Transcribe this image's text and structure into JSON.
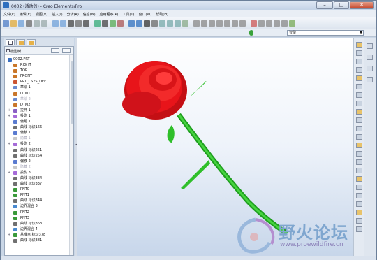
{
  "window": {
    "title": "0002 (活动的) - Creo Elements/Pro",
    "minimize": "–",
    "maximize": "□",
    "close": "✕"
  },
  "menu": [
    "文件(F)",
    "编辑(E)",
    "视图(V)",
    "插入(I)",
    "分析(A)",
    "信息(N)",
    "应用程序(P)",
    "工具(T)",
    "窗口(W)",
    "帮助(H)"
  ],
  "toolbar2": {
    "smart_filter": "智能"
  },
  "panel": {
    "title": "模型树"
  },
  "tree": [
    {
      "label": "0002.PRT",
      "icon": "part-icon",
      "exp": "",
      "dim": false,
      "indent": 0
    },
    {
      "label": "RIGHT",
      "icon": "datum-plane-icon",
      "exp": "",
      "dim": false,
      "indent": 1
    },
    {
      "label": "TOP",
      "icon": "datum-plane-icon",
      "exp": "",
      "dim": false,
      "indent": 1
    },
    {
      "label": "FRONT",
      "icon": "datum-plane-icon",
      "exp": "",
      "dim": false,
      "indent": 1
    },
    {
      "label": "PRT_CSYS_DEF",
      "icon": "csys-icon",
      "exp": "",
      "dim": false,
      "indent": 1
    },
    {
      "label": "草绘 1",
      "icon": "sketch-icon",
      "exp": "",
      "dim": false,
      "indent": 1
    },
    {
      "label": "DTM1",
      "icon": "datum-plane-icon",
      "exp": "",
      "dim": false,
      "indent": 1
    },
    {
      "label": "草绘 2",
      "icon": "sketch-icon",
      "exp": "",
      "dim": true,
      "indent": 1
    },
    {
      "label": "DTM2",
      "icon": "datum-plane-icon",
      "exp": "",
      "dim": false,
      "indent": 1
    },
    {
      "label": "拉伸 1",
      "icon": "extrude-icon",
      "exp": "+",
      "dim": false,
      "indent": 1
    },
    {
      "label": "投影 1",
      "icon": "project-icon",
      "exp": "+",
      "dim": false,
      "indent": 1
    },
    {
      "label": "偏距 1",
      "icon": "offset-icon",
      "exp": "",
      "dim": false,
      "indent": 1
    },
    {
      "label": "曲线 标识166",
      "icon": "curve-icon",
      "exp": "",
      "dim": false,
      "indent": 1
    },
    {
      "label": "偏移 1",
      "icon": "offset-icon",
      "exp": "",
      "dim": false,
      "indent": 1
    },
    {
      "label": "隐藏 1",
      "icon": "hidden-icon",
      "exp": "",
      "dim": true,
      "indent": 1
    },
    {
      "label": "投影 2",
      "icon": "project-icon",
      "exp": "+",
      "dim": false,
      "indent": 1
    },
    {
      "label": "曲线 标识251",
      "icon": "curve-icon",
      "exp": "",
      "dim": false,
      "indent": 1
    },
    {
      "label": "曲线 标识254",
      "icon": "curve-icon",
      "exp": "",
      "dim": false,
      "indent": 1
    },
    {
      "label": "偏移 2",
      "icon": "offset-icon",
      "exp": "",
      "dim": false,
      "indent": 1
    },
    {
      "label": "隐藏 2",
      "icon": "hidden-icon",
      "exp": "",
      "dim": true,
      "indent": 1
    },
    {
      "label": "投影 3",
      "icon": "project-icon",
      "exp": "+",
      "dim": false,
      "indent": 1
    },
    {
      "label": "曲线 标识334",
      "icon": "curve-icon",
      "exp": "",
      "dim": false,
      "indent": 1
    },
    {
      "label": "曲线 标识337",
      "icon": "curve-icon",
      "exp": "",
      "dim": false,
      "indent": 1
    },
    {
      "label": "PNT0",
      "icon": "point-icon",
      "exp": "",
      "dim": false,
      "indent": 1
    },
    {
      "label": "PNT1",
      "icon": "point-icon",
      "exp": "",
      "dim": false,
      "indent": 1
    },
    {
      "label": "曲线 标识344",
      "icon": "curve-icon",
      "exp": "",
      "dim": false,
      "indent": 1
    },
    {
      "label": "边界混合 3",
      "icon": "blend-icon",
      "exp": "",
      "dim": false,
      "indent": 1
    },
    {
      "label": "PNT2",
      "icon": "point-icon",
      "exp": "",
      "dim": false,
      "indent": 1
    },
    {
      "label": "PNT3",
      "icon": "point-icon",
      "exp": "",
      "dim": false,
      "indent": 1
    },
    {
      "label": "曲线 标识363",
      "icon": "curve-icon",
      "exp": "",
      "dim": false,
      "indent": 1
    },
    {
      "label": "边界混合 4",
      "icon": "blend-icon",
      "exp": "",
      "dim": false,
      "indent": 1
    },
    {
      "label": "基准点 标识378",
      "icon": "point-icon",
      "exp": "+",
      "dim": false,
      "indent": 1
    },
    {
      "label": "曲线 标识381",
      "icon": "curve-icon",
      "exp": "",
      "dim": false,
      "indent": 1
    }
  ],
  "watermark": {
    "logo": "野火论坛",
    "url": "www.proewildfire.cn"
  },
  "colors": {
    "accent": "#2e6fbf",
    "rose": "#e8141a",
    "stem": "#2fbf2a"
  }
}
